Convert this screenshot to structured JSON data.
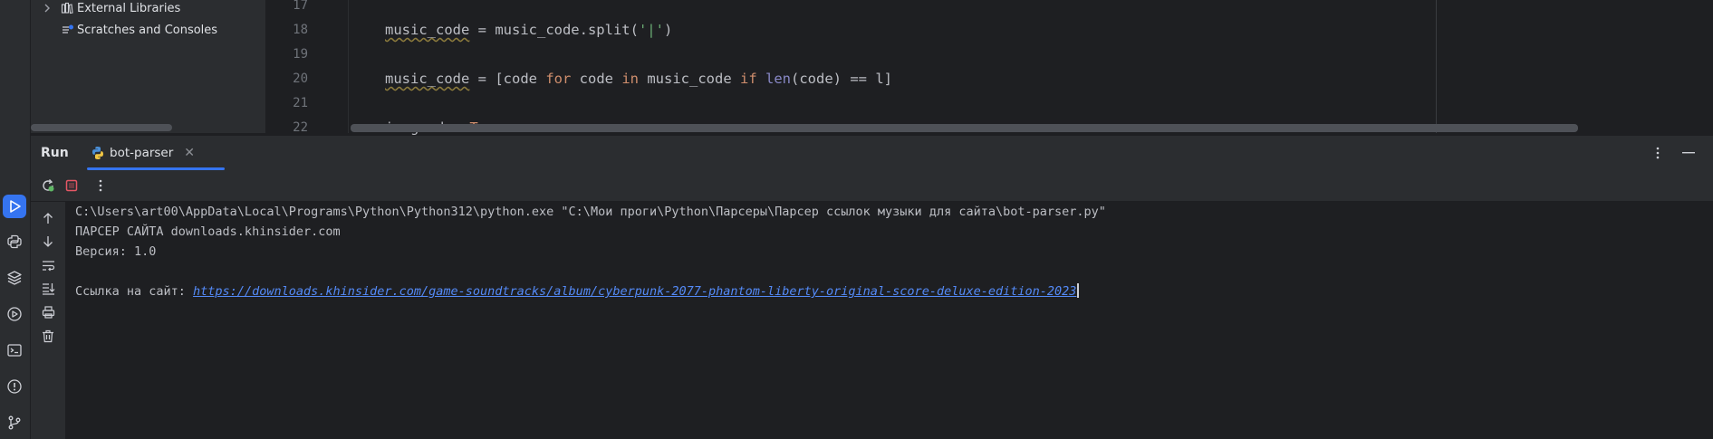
{
  "project_tree": {
    "items": [
      {
        "label": "External Libraries",
        "expandable": true,
        "icon": "library-icon"
      },
      {
        "label": "Scratches and Consoles",
        "expandable": false,
        "icon": "scratches-icon"
      }
    ]
  },
  "editor": {
    "lines": [
      {
        "num": "17"
      },
      {
        "num": "18"
      },
      {
        "num": "19"
      },
      {
        "num": "20"
      },
      {
        "num": "21"
      },
      {
        "num": "22"
      }
    ],
    "code": {
      "l18": {
        "var": "music_code",
        "rest1": " = music_code.split(",
        "str": "'|'",
        "rest2": ")"
      },
      "l20": {
        "var": "music_code",
        "p1": " = [code ",
        "kw_for": "for",
        "p2": " code ",
        "kw_in": "in",
        "p3": " music_code ",
        "kw_if": "if",
        "p4": " ",
        "fn_len": "len",
        "p5": "(code) == l]"
      },
      "l22": {
        "p1": "is_good = ",
        "kw_true": "True"
      }
    }
  },
  "run_panel": {
    "title": "Run",
    "tab_label": "bot-parser"
  },
  "console": {
    "line1": "C:\\Users\\art00\\AppData\\Local\\Programs\\Python\\Python312\\python.exe \"C:\\Мои проги\\Python\\Парсеры\\Парсер ссылок музыки для сайта\\bot-parser.py\"",
    "line2": "ПАРСЕР САЙТА downloads.khinsider.com",
    "line3": "Версия: 1.0",
    "prompt": "Ссылка на сайт: ",
    "input_url": "https://downloads.khinsider.com/game-soundtracks/album/cyberpunk-2077-phantom-liberty-original-score-deluxe-edition-2023"
  },
  "colors": {
    "accent": "#3574f0",
    "background": "#1e1f22",
    "panel": "#2b2d30",
    "link": "#548af7",
    "stop_red": "#e55765",
    "rerun_green": "#5fb865"
  }
}
